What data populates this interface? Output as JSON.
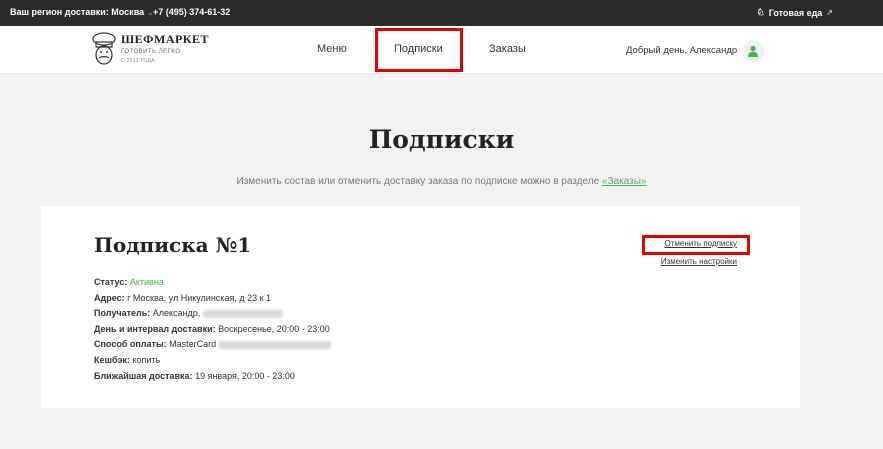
{
  "topbar": {
    "region": "Ваш регион доставки: Москва",
    "phone": "+7 (495) 374-61-32",
    "ready_food": "Готовая еда"
  },
  "header": {
    "logo_name": "ШЕФМАРКЕТ",
    "logo_tagline": "ГОТОВИТЬ ЛЕГКО",
    "logo_since": "С 2012 ГОДА",
    "nav": {
      "menu": "Меню",
      "subscriptions": "Подписки",
      "orders": "Заказы"
    },
    "greeting": "Добрый день, Александр"
  },
  "main": {
    "title": "Подписки",
    "hint_text": "Изменить состав или отменить доставку заказа по подписке можно в разделе ",
    "hint_link": "«Заказы»"
  },
  "subscription": {
    "title": "Подписка №1",
    "cancel_label": "Отменить подписку",
    "settings_label": "Изменить настройки",
    "status_label": "Статус:",
    "status_value": "Активна",
    "address_label": "Адрес:",
    "address_value": "г Москва, ул Никулинская, д 23 к 1",
    "recipient_label": "Получатель:",
    "recipient_value": "Александр,",
    "delivery_label": "День и интервал доставки:",
    "delivery_value": "Воскресенье, 20:00 - 23:00",
    "payment_label": "Способ оплаты:",
    "payment_value": "MasterCard",
    "cashback_label": "Кешбэк:",
    "cashback_value": "копить",
    "next_label": "Ближайшая доставка:",
    "next_value": "19 января, 20:00 - 23:00"
  },
  "colors": {
    "accent": "#4caf50",
    "highlight": "#e60000",
    "topbar": "#2b2b2b"
  }
}
